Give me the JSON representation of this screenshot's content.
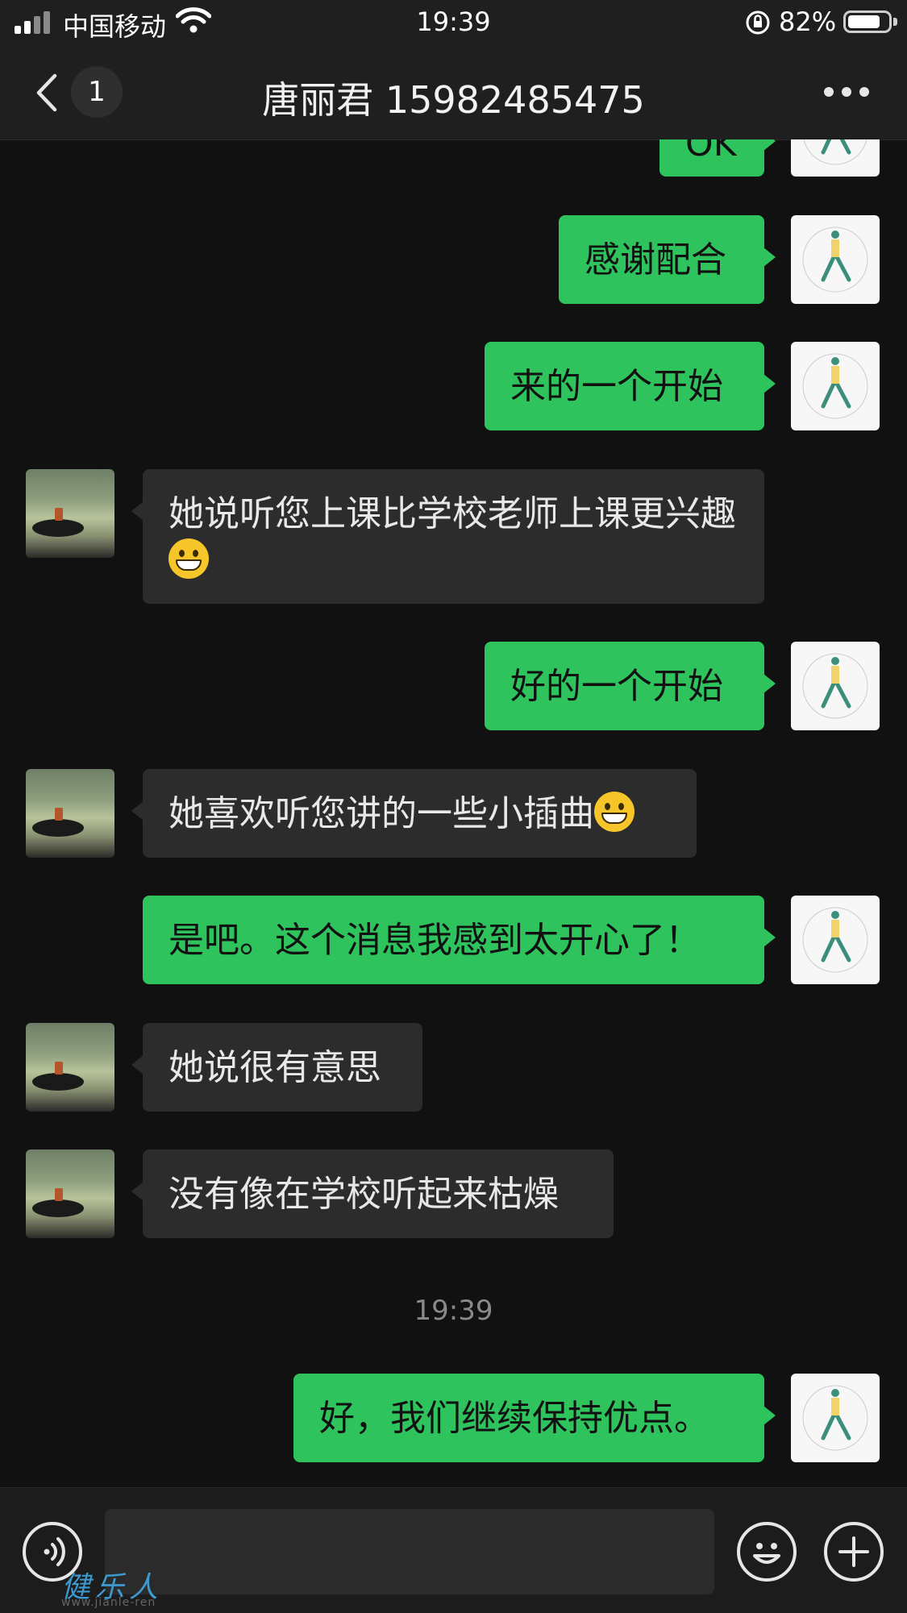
{
  "status_bar": {
    "carrier": "中国移动",
    "time": "19:39",
    "battery_percent": "82%",
    "battery_level": 0.82
  },
  "nav": {
    "back_icon": "chevron-left-icon",
    "unread_count": "1",
    "title": "唐丽君 15982485475",
    "more_icon": "more-dots-icon"
  },
  "messages": [
    {
      "from": "me",
      "text": "OK"
    },
    {
      "from": "me",
      "text": "感谢配合"
    },
    {
      "from": "me",
      "text": "来的一个开始"
    },
    {
      "from": "other",
      "text": "她说听您上课比学校老师上课更兴趣",
      "emoji": "grinning-face"
    },
    {
      "from": "me",
      "text": "好的一个开始"
    },
    {
      "from": "other",
      "text": "她喜欢听您讲的一些小插曲",
      "emoji": "grinning-face"
    },
    {
      "from": "me",
      "text": "是吧。这个消息我感到太开心了！"
    },
    {
      "from": "other",
      "text": "她说很有意思"
    },
    {
      "from": "other",
      "text": "没有像在学校听起来枯燥"
    },
    {
      "from": "timestamp",
      "text": "19:39"
    },
    {
      "from": "me",
      "text": "好，我们继续保持优点。"
    }
  ],
  "input_bar": {
    "voice_icon": "voice-icon",
    "emoji_icon": "emoji-icon",
    "plus_icon": "plus-icon"
  },
  "watermark": {
    "brand": "健乐人",
    "url": "www.jianle-ren"
  },
  "colors": {
    "accent_bubble": "#2fc35d",
    "other_bubble": "#2c2c2c",
    "background": "#111111"
  }
}
